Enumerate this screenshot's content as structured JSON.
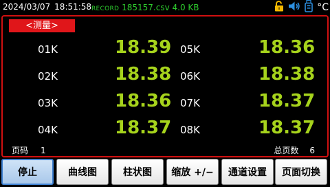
{
  "status": {
    "date": "2024/03/07",
    "time": "18:51:58",
    "record_label": "RECORD",
    "file_name": "185157.csv",
    "file_size": "4.0 KB",
    "temp_unit": "°C",
    "record_color": "#2ecc2e"
  },
  "mode_tab": "<测量>",
  "channels": [
    {
      "label": "01K",
      "value": "18.39"
    },
    {
      "label": "02K",
      "value": "18.38"
    },
    {
      "label": "03K",
      "value": "18.36"
    },
    {
      "label": "04K",
      "value": "18.37"
    },
    {
      "label": "05K",
      "value": "18.36"
    },
    {
      "label": "06K",
      "value": "18.38"
    },
    {
      "label": "07K",
      "value": "18.37"
    },
    {
      "label": "08K",
      "value": "18.37"
    }
  ],
  "footer": {
    "page_label": "页码",
    "page_num": "1",
    "total_label": "总页数",
    "total_num": "6"
  },
  "buttons": {
    "stop": "停止",
    "curve": "曲线图",
    "bar": "柱状图",
    "zoom": "缩放 +/−",
    "channel_settings": "通道设置",
    "page_switch": "页面切换"
  },
  "colors": {
    "value": "#a6d31c",
    "frame": "#d01010",
    "tag": "#e0161a"
  }
}
